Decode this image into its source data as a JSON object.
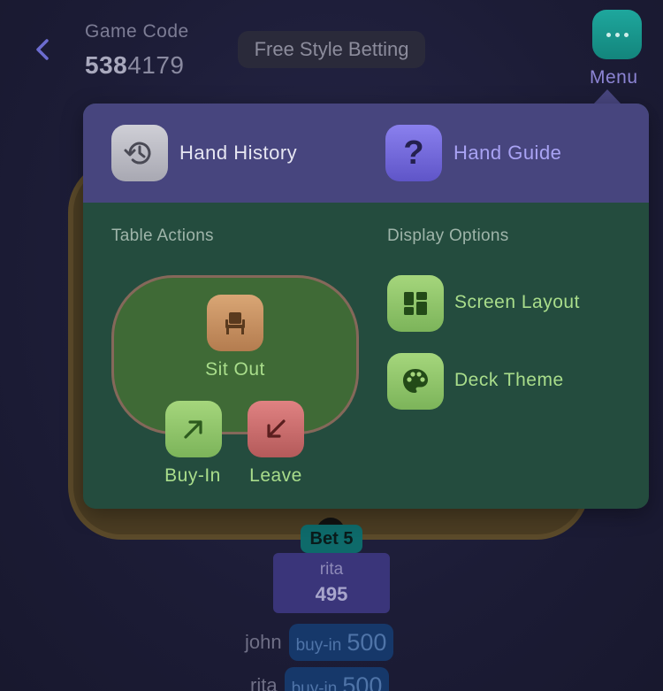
{
  "header": {
    "game_code_label": "Game Code",
    "game_code_strong": "538",
    "game_code_rest": "4179",
    "mode": "Free Style Betting",
    "menu_label": "Menu"
  },
  "menu_popover": {
    "top": {
      "hand_history": "Hand History",
      "hand_guide": "Hand Guide",
      "hand_guide_icon_text": "?"
    },
    "table_actions": {
      "title": "Table Actions",
      "sit_out": "Sit Out",
      "buy_in": "Buy-In",
      "leave": "Leave"
    },
    "display_options": {
      "title": "Display Options",
      "screen_layout": "Screen Layout",
      "deck_theme": "Deck Theme"
    }
  },
  "table": {
    "bet_badge": "Bet 5",
    "player": {
      "name": "rita",
      "chips": "495"
    }
  },
  "action_log": [
    {
      "name": "john",
      "action": "buy-in",
      "amount": "500"
    },
    {
      "name": "rita",
      "action": "buy-in",
      "amount": "500"
    }
  ],
  "colors": {
    "background": "#1f1f3a",
    "accent_teal": "#1ea79d",
    "popover_top": "#47457e",
    "popover_body": "#244c3e",
    "label_green": "#a9dd8b",
    "guide_purple": "#a9a3f4"
  },
  "icons": {
    "back": "chevron-left-icon",
    "menu": "more-dots-icon",
    "history": "history-clock-icon",
    "guide": "question-mark-icon",
    "sit_out": "chair-icon",
    "buy_in": "arrow-up-right-icon",
    "leave": "arrow-down-left-icon",
    "layout": "layout-grid-icon",
    "theme": "palette-icon"
  }
}
